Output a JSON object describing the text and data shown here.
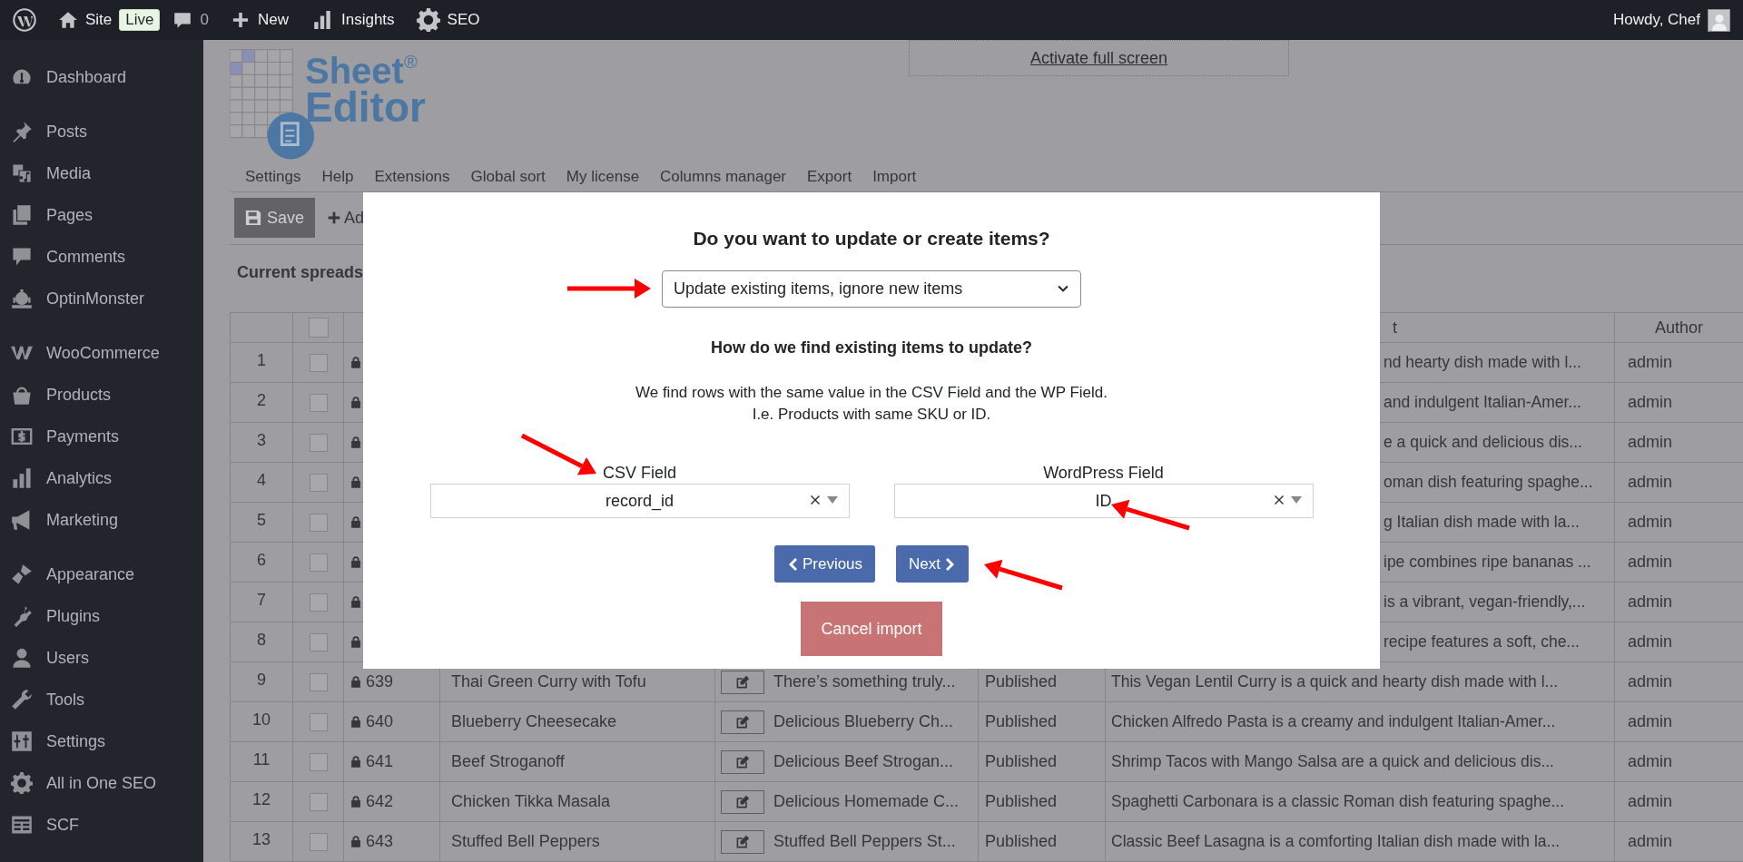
{
  "admin_bar": {
    "site": "Site",
    "badge": "Live",
    "comments": "0",
    "new": "New",
    "insights": "Insights",
    "seo": "SEO",
    "greeting": "Howdy, Chef"
  },
  "sidebar": {
    "groups": [
      [
        "Dashboard"
      ],
      [
        "Posts",
        "Media",
        "Pages",
        "Comments",
        "OptinMonster"
      ],
      [
        "WooCommerce",
        "Products",
        "Payments",
        "Analytics",
        "Marketing"
      ],
      [
        "Appearance",
        "Plugins",
        "Users",
        "Tools",
        "Settings",
        "All in One SEO",
        "SCF"
      ]
    ]
  },
  "logo": {
    "word1": "Sheet",
    "registered": "®",
    "word2": "Editor"
  },
  "fullscreen_link": "Activate full screen",
  "menu": [
    "Settings",
    "Help",
    "Extensions",
    "Global sort",
    "My license",
    "Columns manager",
    "Export",
    "Import"
  ],
  "toolbar": {
    "save": "Save",
    "add": "Ad"
  },
  "current_label": "Current spreads",
  "table": {
    "header": {
      "checked": false,
      "excerpt": "t",
      "author": "Author"
    },
    "rows": [
      {
        "kind": "covered",
        "number": "1",
        "checked": false,
        "excerpt": "nd hearty dish made with l...",
        "author": "admin"
      },
      {
        "kind": "covered",
        "number": "2",
        "checked": false,
        "excerpt": "and indulgent Italian-Amer...",
        "author": "admin"
      },
      {
        "kind": "covered",
        "number": "3",
        "checked": false,
        "excerpt": "e a quick and delicious dis...",
        "author": "admin"
      },
      {
        "kind": "covered",
        "number": "4",
        "checked": false,
        "excerpt": "oman dish featuring spaghe...",
        "author": "admin"
      },
      {
        "kind": "covered",
        "number": "5",
        "checked": false,
        "excerpt": "g Italian dish made with la...",
        "author": "admin"
      },
      {
        "kind": "covered",
        "number": "6",
        "checked": false,
        "excerpt": "ipe combines ripe bananas ...",
        "author": "admin"
      },
      {
        "kind": "covered",
        "number": "7",
        "checked": false,
        "excerpt": "is a vibrant, vegan-friendly,...",
        "author": "admin"
      },
      {
        "kind": "covered",
        "number": "8",
        "checked": false,
        "excerpt": "recipe features a soft, che...",
        "author": "admin"
      },
      {
        "kind": "full",
        "number": "9",
        "checked": false,
        "id": "639",
        "title": "Thai Green Curry with Tofu",
        "content": "There’s something truly...",
        "status": "Published",
        "excerpt": "This Vegan Lentil Curry is a quick and hearty dish made with l...",
        "author": "admin"
      },
      {
        "kind": "full",
        "number": "10",
        "checked": false,
        "id": "640",
        "title": "Blueberry Cheesecake",
        "content": "Delicious Blueberry Ch...",
        "status": "Published",
        "excerpt": "Chicken Alfredo Pasta is a creamy and indulgent Italian-Amer...",
        "author": "admin"
      },
      {
        "kind": "full",
        "number": "11",
        "checked": false,
        "id": "641",
        "title": "Beef Stroganoff",
        "content": "Delicious Beef Strogan...",
        "status": "Published",
        "excerpt": "Shrimp Tacos with Mango Salsa are a quick and delicious dis...",
        "author": "admin"
      },
      {
        "kind": "full",
        "number": "12",
        "checked": false,
        "id": "642",
        "title": "Chicken Tikka Masala",
        "content": "Delicious Homemade C...",
        "status": "Published",
        "excerpt": "Spaghetti Carbonara is a classic Roman dish featuring spaghe...",
        "author": "admin"
      },
      {
        "kind": "full",
        "number": "13",
        "checked": false,
        "id": "643",
        "title": "Stuffed Bell Peppers",
        "content": "Stuffed Bell Peppers St...",
        "status": "Published",
        "excerpt": "Classic Beef Lasagna is a comforting Italian dish made with la...",
        "author": "admin"
      }
    ]
  },
  "modal": {
    "question": "Do you want to update or create items?",
    "mode_select": "Update existing items, ignore new items",
    "subheading": "How do we find existing items to update?",
    "explanation": [
      "We find rows with the same value in the CSV Field and the WP Field.",
      "I.e. Products with same SKU or ID."
    ],
    "fields": [
      {
        "label": "CSV Field",
        "value": "record_id"
      },
      {
        "label": "WordPress Field",
        "value": "ID"
      }
    ],
    "previous": "Previous",
    "next": "Next",
    "cancel": "Cancel import"
  }
}
